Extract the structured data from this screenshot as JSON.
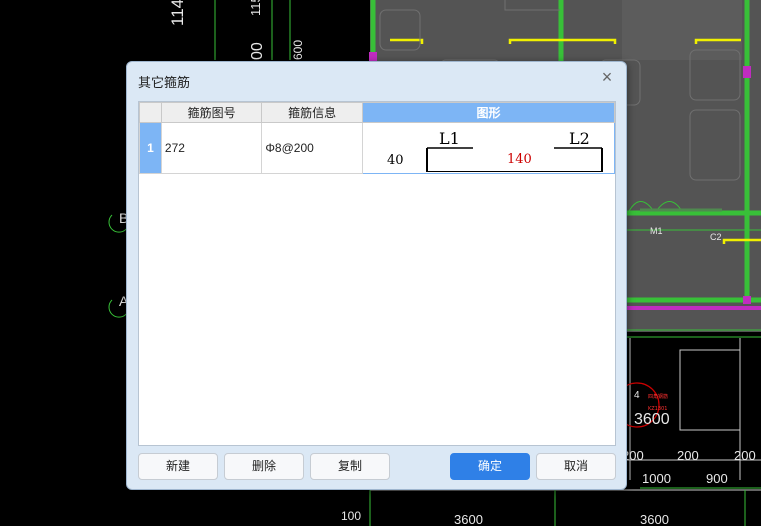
{
  "background": {
    "labels": {
      "top_num_a": "114",
      "top_num_b": "115",
      "vert_00": "00",
      "vert_600": "600",
      "side_b": "B",
      "side_a": "A",
      "door": "M1",
      "window": "C2",
      "axis_num": "4",
      "red_note_1": "四角钢筋",
      "red_note_2": "KZ1301",
      "dim_3600_mid": "3600",
      "dim_200_a": "200",
      "dim_200_b": "200",
      "dim_200_c": "200",
      "dim_1000": "1000",
      "dim_900": "900",
      "dim_100": "100",
      "dim_3600_b1": "3600",
      "dim_3600_b2": "3600"
    }
  },
  "dialog": {
    "title": "其它箍筋",
    "close_label": "×",
    "table": {
      "columns": [
        "",
        "箍筋图号",
        "箍筋信息",
        "图形"
      ],
      "rows": [
        {
          "num": "1",
          "shape_no": "272",
          "info": "Φ8@200",
          "shape": {
            "label_l1": "L1",
            "label_l2": "L2",
            "left_value": "40",
            "center_value": "140"
          }
        }
      ]
    },
    "buttons": {
      "new": "新建",
      "delete": "删除",
      "copy": "复制",
      "ok": "确定",
      "cancel": "取消"
    }
  },
  "colors": {
    "accent": "#2f80e7",
    "header_active": "#7db5f5",
    "cad_green": "#38c038",
    "cad_yellow": "#f0f000",
    "cad_magenta": "#c02cc0",
    "shape_red": "#cc0000"
  }
}
